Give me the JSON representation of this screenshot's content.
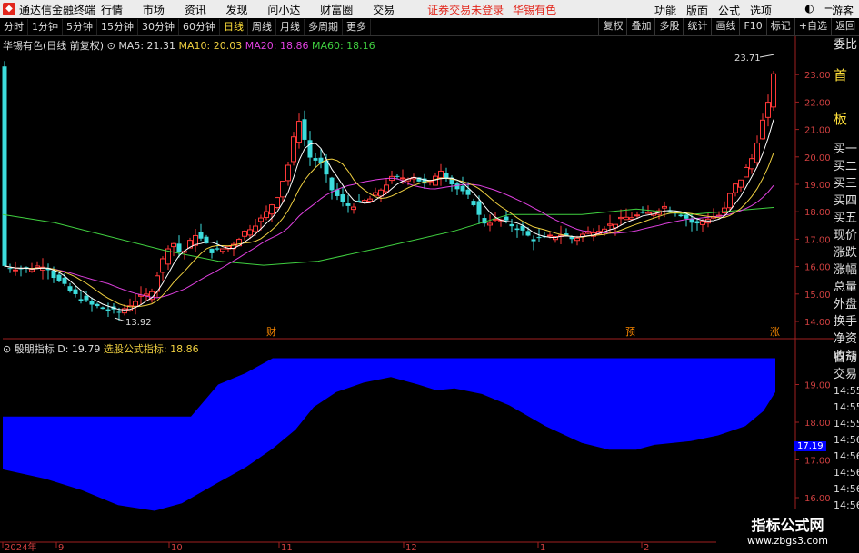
{
  "titlebar": {
    "app_title": "通达信金融终端",
    "menu": [
      "行情",
      "市场",
      "资讯",
      "发现",
      "问小达",
      "财富圈",
      "交易"
    ],
    "notice": "证券交易未登录",
    "stock_name": "华锡有色",
    "right_menu": [
      "功能",
      "版面",
      "公式",
      "选项"
    ],
    "guest": "游客"
  },
  "toolbar": {
    "periods": [
      "分时",
      "1分钟",
      "5分钟",
      "15分钟",
      "30分钟",
      "60分钟",
      "日线",
      "周线",
      "月线",
      "多周期",
      "更多"
    ],
    "active": "日线",
    "right_buttons": [
      "复权",
      "叠加",
      "多股",
      "统计",
      "画线",
      "F10",
      "标记",
      "+自选",
      "返回"
    ]
  },
  "main_legend": {
    "title": "华锡有色(日线 前复权)",
    "ma5": "MA5: 21.31",
    "ma10": "MA10: 20.03",
    "ma20": "MA20: 18.86",
    "ma60": "MA60: 18.16"
  },
  "sub_legend": {
    "title": "殷朋指标",
    "d": "D: 19.79",
    "formula": "选股公式指标: 18.86"
  },
  "price_axis": [
    "23.00",
    "22.00",
    "21.00",
    "20.00",
    "19.00",
    "18.00",
    "17.00",
    "16.00",
    "15.00",
    "14.00"
  ],
  "sub_axis": [
    "19.00",
    "18.00",
    "17.00",
    "16.00"
  ],
  "annotations": {
    "high": "23.71",
    "low": "13.92",
    "current_sub": "17.19"
  },
  "markers": [
    "财",
    "预",
    "涨"
  ],
  "date_axis": [
    "2024年",
    "9",
    "10",
    "11",
    "12",
    "1",
    "2"
  ],
  "side_panel": [
    "委比",
    "首 板",
    "买一",
    "买二",
    "买三",
    "买四",
    "买五",
    "现价",
    "涨跌",
    "涨幅",
    "总量",
    "外盘",
    "换手",
    "净资",
    "收益"
  ],
  "side_panel2": [
    "自动",
    "交易",
    "14:55",
    "14:55",
    "14:55",
    "14:56",
    "14:56",
    "14:56",
    "14:56",
    "14:56"
  ],
  "watermark": {
    "line1": "指标公式网",
    "line2": "www.zbgs3.com"
  },
  "colors": {
    "up": "#ff3838",
    "down": "#3cdcdc",
    "ma5": "#ffffff",
    "ma10": "#f0d040",
    "ma20": "#e040e0",
    "ma60": "#40d040",
    "band": "#0000ff"
  }
}
